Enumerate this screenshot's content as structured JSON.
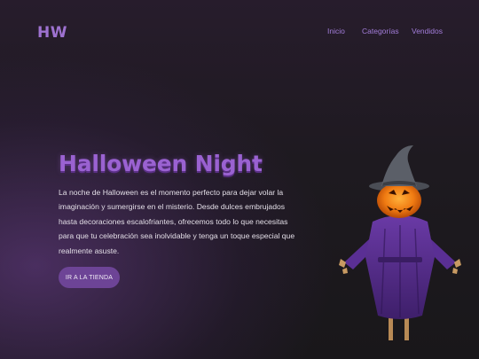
{
  "brand": {
    "logo": "HW"
  },
  "nav": {
    "items": [
      "Inicio",
      "Categorías",
      "Vendidos"
    ],
    "color": "#a27dd9"
  },
  "hero": {
    "title": "Halloween Night",
    "description": "La noche de Halloween es el momento perfecto para dejar volar la imaginación y sumergirse en el misterio. Desde dulces embrujados hasta decoraciones escalofriantes, ofrecemos todo lo que necesitas para que tu celebración sea inolvidable y tenga un toque especial que realmente asuste.",
    "button_label": "IR A LA TIENDA"
  },
  "illustration": {
    "icon": "pumpkin-scarecrow-icon"
  },
  "colors": {
    "accent": "#9a62d1",
    "button": "#6d4496",
    "background": "#1e1a20"
  }
}
